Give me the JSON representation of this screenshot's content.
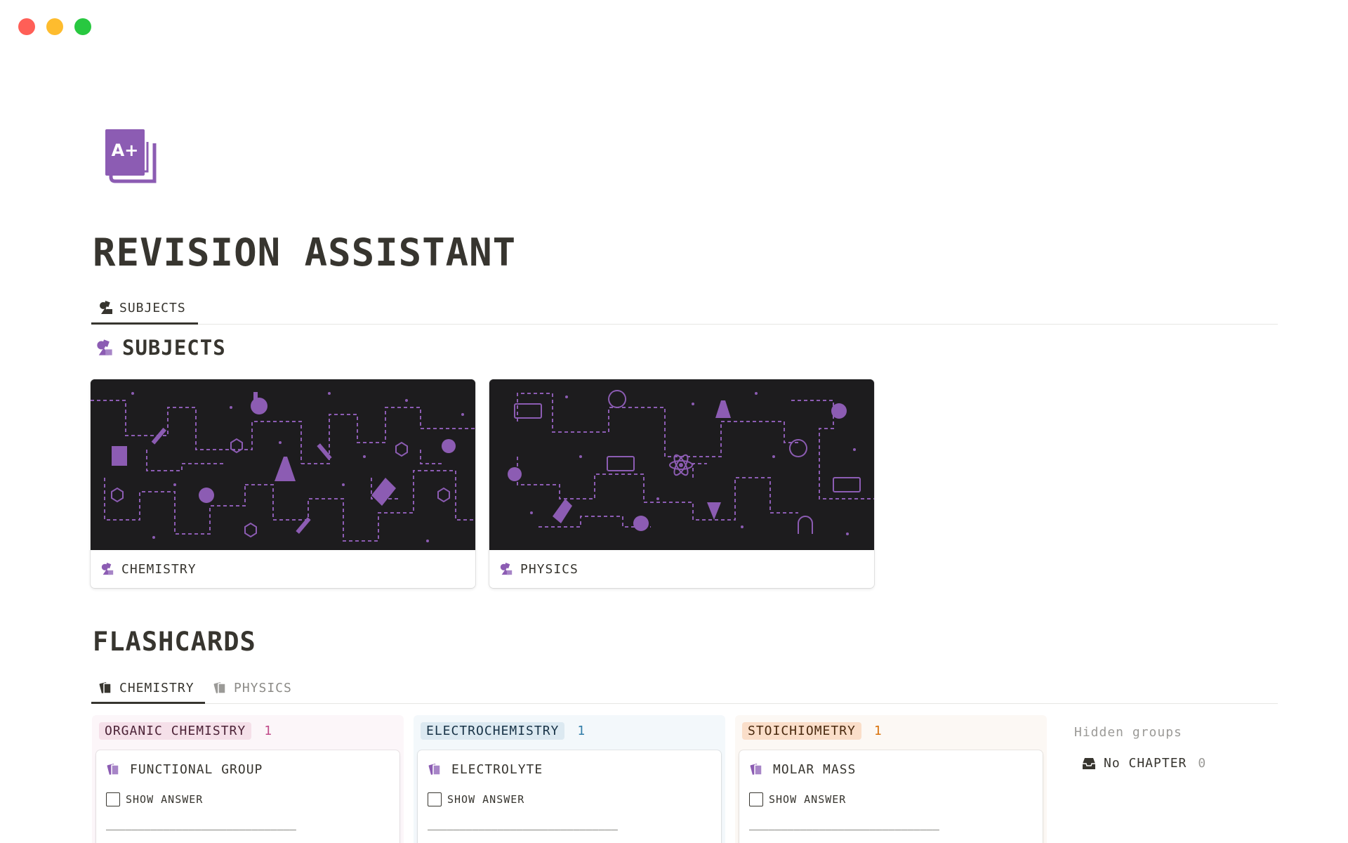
{
  "page": {
    "title": "REVISION ASSISTANT",
    "icon": "a-plus-grade-icon"
  },
  "top_tabs": [
    {
      "label": "SUBJECTS",
      "icon": "shapes-icon",
      "active": true
    }
  ],
  "subjects_section": {
    "heading": "SUBJECTS",
    "icon": "shapes-icon",
    "cards": [
      {
        "title": "CHEMISTRY",
        "icon": "shapes-icon",
        "cover": "chemistry-pattern"
      },
      {
        "title": "PHYSICS",
        "icon": "shapes-icon",
        "cover": "physics-pattern"
      }
    ]
  },
  "flashcards_section": {
    "heading": "FLASHCARDS",
    "tabs": [
      {
        "label": "CHEMISTRY",
        "icon": "cards-icon",
        "active": true
      },
      {
        "label": "PHYSICS",
        "icon": "cards-icon",
        "active": false
      }
    ],
    "groups": [
      {
        "name": "ORGANIC CHEMISTRY",
        "count": "1",
        "color": "#c14c8a",
        "card": {
          "title": "FUNCTIONAL GROUP",
          "toggle": "SHOW ANSWER",
          "divider": "______________________________"
        }
      },
      {
        "name": "ELECTROCHEMISTRY",
        "count": "1",
        "color": "#337ea9",
        "card": {
          "title": "ELECTROLYTE",
          "toggle": "SHOW ANSWER",
          "divider": "______________________________"
        }
      },
      {
        "name": "STOICHIOMETRY",
        "count": "1",
        "color": "#d9730d",
        "card": {
          "title": "MOLAR MASS",
          "toggle": "SHOW ANSWER",
          "divider": "______________________________"
        }
      }
    ],
    "hidden_groups": {
      "label": "Hidden groups",
      "items": [
        {
          "label": "No CHAPTER",
          "count": "0",
          "icon": "inbox-icon"
        }
      ]
    }
  },
  "colors": {
    "accent_purple": "#8c5cb3",
    "cover_bg": "#1d1c1e",
    "text": "#37352f"
  }
}
